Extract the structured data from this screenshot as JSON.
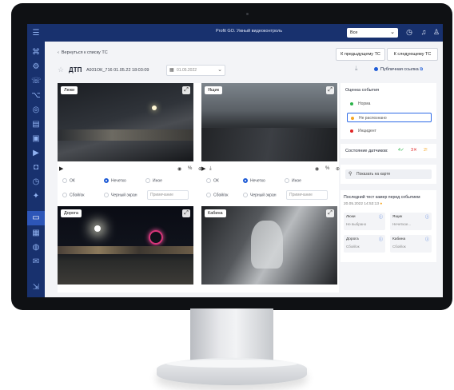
{
  "app": {
    "title": "Profit GO. Умный видеоконтроль"
  },
  "topbar": {
    "select_value": "Все",
    "icons": [
      "clock-icon",
      "bell-icon",
      "user-icon"
    ]
  },
  "sidebar": {
    "icons": [
      "menu-icon",
      "map-icon",
      "gear-icon",
      "phone-icon",
      "route-icon",
      "wheel-icon",
      "chart-icon",
      "truck-icon",
      "video-icon",
      "lock-icon",
      "clock-icon",
      "settings-icon",
      "monitor-icon",
      "grid-icon",
      "globe-icon",
      "message-icon"
    ]
  },
  "header": {
    "back_label": "Вернуться к списку ТС",
    "prev_label": "К предыдущему ТС",
    "next_label": "К следующему ТС",
    "event_type": "ДТП",
    "plate_and_time": "А931ОК_716  01.05.22  18:03:09",
    "date_value": "01.05.2022",
    "public_link": "Публичная ссылка"
  },
  "cameras": [
    {
      "label": "Люки"
    },
    {
      "label": "Ящик"
    },
    {
      "label": "Дорога"
    },
    {
      "label": "Кабина"
    }
  ],
  "camera_options": {
    "ok": "ОК",
    "unclear": "Нечетко",
    "other": "Иное",
    "rejected": "Сбой/ок",
    "black_screen": "Черный экран",
    "comment_placeholder": "Примечание"
  },
  "event_rating": {
    "title": "Оценка события",
    "options": [
      {
        "label": "Норма",
        "color": "#2bb34a",
        "selected": false
      },
      {
        "label": "Не распознано",
        "color": "#f5a623",
        "selected": true
      },
      {
        "label": "Инцидент",
        "color": "#e02424",
        "selected": false
      }
    ]
  },
  "sensors": {
    "title": "Состояние датчиков:",
    "values": [
      {
        "count": "4",
        "color": "#2bb34a",
        "symbol": "✓"
      },
      {
        "count": "3",
        "color": "#e02424",
        "symbol": "✕"
      },
      {
        "count": "2",
        "color": "#f5a623",
        "symbol": "!"
      }
    ]
  },
  "map": {
    "label": "Показать на карте"
  },
  "last_test": {
    "title": "Последний тест камер перед событием",
    "datetime": "20.05.2022 14:53:13",
    "cells": [
      {
        "name": "Люки",
        "status": "Не выбрано"
      },
      {
        "name": "Ящик",
        "status": "Нечеткое..."
      },
      {
        "name": "Дорога",
        "status": "Сбой/ок"
      },
      {
        "name": "Кабина",
        "status": "Сбой/ок"
      }
    ]
  }
}
